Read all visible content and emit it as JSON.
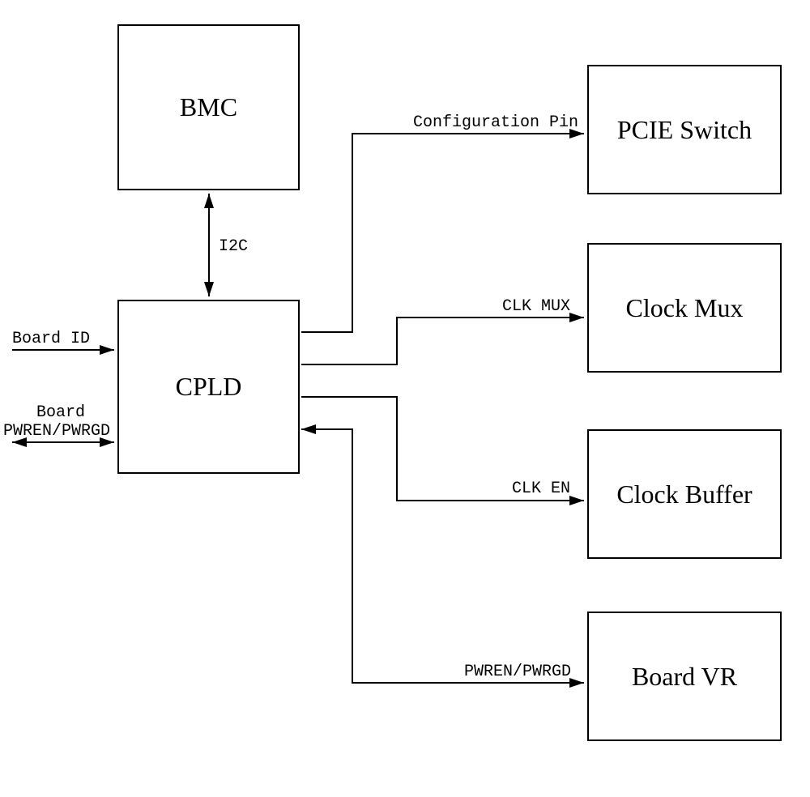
{
  "boxes": {
    "bmc": "BMC",
    "cpld": "CPLD",
    "pcie_switch": "PCIE Switch",
    "clock_mux": "Clock Mux",
    "clock_buffer": "Clock Buffer",
    "board_vr": "Board VR"
  },
  "connections": {
    "i2c": "I2C",
    "config_pin": "Configuration Pin",
    "clk_mux": "CLK MUX",
    "clk_en": "CLK EN",
    "pwren_pwrgd": "PWREN/PWRGD"
  },
  "inputs": {
    "board_id": "Board ID",
    "board_pwr_line1": "Board",
    "board_pwr_line2": "PWREN/PWRGD"
  }
}
